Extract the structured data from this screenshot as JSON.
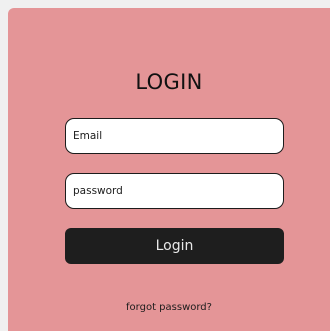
{
  "login": {
    "title": "LOGIN",
    "email_placeholder": "Email",
    "email_value": "",
    "password_placeholder": "password",
    "password_value": "",
    "submit_label": "Login",
    "forgot_label": "forgot password?"
  },
  "colors": {
    "card_background": "#e49597",
    "button_background": "#1e1e1e",
    "input_background": "#ffffff"
  }
}
